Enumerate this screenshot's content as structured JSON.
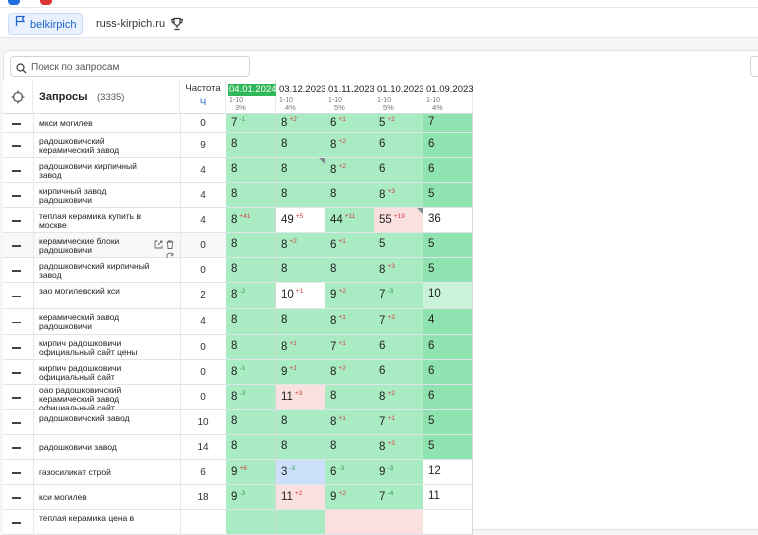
{
  "tabs": [
    {
      "label": "belkirpich",
      "active": true
    },
    {
      "label": "russ-kirpich.ru",
      "active": false
    }
  ],
  "search": {
    "placeholder": "Поиск по запросам"
  },
  "header": {
    "query_title": "Запросы",
    "query_count": "(3335)",
    "freq_title": "Частота",
    "freq_unit": "Ч"
  },
  "dates": [
    {
      "date": "04.01.2024",
      "range": "1-10",
      "pct": "3%",
      "current": true
    },
    {
      "date": "03.12.2023",
      "range": "1-10",
      "pct": "4%",
      "current": false
    },
    {
      "date": "01.11.2023",
      "range": "1-10",
      "pct": "5%",
      "current": false
    },
    {
      "date": "01.10.2023",
      "range": "1-10",
      "pct": "5%",
      "current": false
    },
    {
      "date": "01.09.2023",
      "range": "1-10",
      "pct": "4%",
      "current": false
    }
  ],
  "colors": {
    "green_light": "#c9f3d8",
    "green": "#a9ecc4",
    "green_strong": "#8fe3b0",
    "pink": "#fbe0e0",
    "blue": "#cde0fb",
    "white": "#ffffff",
    "accent": "#1f64c8",
    "current_date": "#2fb85a"
  },
  "rows": [
    {
      "query": "мкси могилев",
      "freq": "0",
      "cells": [
        [
          "7",
          "-1",
          "dn",
          "g",
          0
        ],
        [
          "8",
          "+2",
          "up",
          "g",
          0
        ],
        [
          "6",
          "+1",
          "up",
          "g",
          0
        ],
        [
          "5",
          "+2",
          "up",
          "g",
          0
        ],
        [
          "7",
          "",
          "",
          "gs",
          0
        ]
      ]
    },
    {
      "query": "радошковичский керамический завод",
      "freq": "9",
      "cells": [
        [
          "8",
          "",
          "",
          "g",
          0
        ],
        [
          "8",
          "",
          "",
          "g",
          0
        ],
        [
          "8",
          "+2",
          "up",
          "g",
          0
        ],
        [
          "6",
          "",
          "",
          "g",
          0
        ],
        [
          "6",
          "",
          "",
          "gs",
          0
        ]
      ]
    },
    {
      "query": "радошковичи кирпичный завод",
      "freq": "4",
      "cells": [
        [
          "8",
          "",
          "",
          "g",
          0
        ],
        [
          "8",
          "",
          "",
          "g",
          1
        ],
        [
          "8",
          "+2",
          "up",
          "g",
          0
        ],
        [
          "6",
          "",
          "",
          "g",
          0
        ],
        [
          "6",
          "",
          "",
          "gs",
          0
        ]
      ]
    },
    {
      "query": "кирпичный завод радошковичи",
      "freq": "4",
      "cells": [
        [
          "8",
          "",
          "",
          "g",
          0
        ],
        [
          "8",
          "",
          "",
          "g",
          0
        ],
        [
          "8",
          "",
          "",
          "g",
          0
        ],
        [
          "8",
          "+3",
          "up",
          "g",
          0
        ],
        [
          "5",
          "",
          "",
          "gs",
          0
        ]
      ]
    },
    {
      "query": "теплая керамика купить в москве",
      "freq": "4",
      "cells": [
        [
          "8",
          "+41",
          "up",
          "g",
          0
        ],
        [
          "49",
          "+5",
          "up",
          "w",
          0
        ],
        [
          "44",
          "+11",
          "up",
          "g",
          0
        ],
        [
          "55",
          "+19",
          "up",
          "p",
          1
        ],
        [
          "36",
          "",
          "",
          "w",
          0
        ]
      ]
    },
    {
      "query": "керамические блоки радошковичи",
      "freq": "0",
      "hl": true,
      "cells": [
        [
          "8",
          "",
          "",
          "g",
          0
        ],
        [
          "8",
          "+2",
          "up",
          "g",
          0
        ],
        [
          "6",
          "+1",
          "up",
          "g",
          0
        ],
        [
          "5",
          "",
          "",
          "g",
          0
        ],
        [
          "5",
          "",
          "",
          "gs",
          0
        ]
      ]
    },
    {
      "query": "радошковичский кирпичный завод",
      "freq": "0",
      "cells": [
        [
          "8",
          "",
          "",
          "g",
          0
        ],
        [
          "8",
          "",
          "",
          "g",
          0
        ],
        [
          "8",
          "",
          "",
          "g",
          0
        ],
        [
          "8",
          "+3",
          "up",
          "g",
          0
        ],
        [
          "5",
          "",
          "",
          "gs",
          0
        ]
      ]
    },
    {
      "query": "зао могилевский кси",
      "freq": "2",
      "cells": [
        [
          "8",
          "-2",
          "dn",
          "g",
          0
        ],
        [
          "10",
          "+1",
          "up",
          "w",
          0
        ],
        [
          "9",
          "+2",
          "up",
          "g",
          0
        ],
        [
          "7",
          "-3",
          "dn",
          "g",
          0
        ],
        [
          "10",
          "",
          "",
          "gl",
          0
        ]
      ]
    },
    {
      "query": "керамический завод радошковичи",
      "freq": "4",
      "cells": [
        [
          "8",
          "",
          "",
          "g",
          0
        ],
        [
          "8",
          "",
          "",
          "g",
          0
        ],
        [
          "8",
          "+1",
          "up",
          "g",
          0
        ],
        [
          "7",
          "+3",
          "up",
          "g",
          0
        ],
        [
          "4",
          "",
          "",
          "gs",
          0
        ]
      ]
    },
    {
      "query": "кирпич радошковичи официальный сайт цены",
      "freq": "0",
      "cells": [
        [
          "8",
          "",
          "",
          "g",
          0
        ],
        [
          "8",
          "+1",
          "up",
          "g",
          0
        ],
        [
          "7",
          "+1",
          "up",
          "g",
          0
        ],
        [
          "6",
          "",
          "",
          "g",
          0
        ],
        [
          "6",
          "",
          "",
          "gs",
          0
        ]
      ]
    },
    {
      "query": "кирпич радошковичи официальный сайт",
      "freq": "0",
      "cells": [
        [
          "8",
          "-1",
          "dn",
          "g",
          0
        ],
        [
          "9",
          "+1",
          "up",
          "g",
          0
        ],
        [
          "8",
          "+2",
          "up",
          "g",
          0
        ],
        [
          "6",
          "",
          "",
          "g",
          0
        ],
        [
          "6",
          "",
          "",
          "gs",
          0
        ]
      ]
    },
    {
      "query": "оао радошковичский керамический завод официальный сайт",
      "freq": "0",
      "cells": [
        [
          "8",
          "-3",
          "dn",
          "g",
          0
        ],
        [
          "11",
          "+3",
          "up",
          "p",
          0
        ],
        [
          "8",
          "",
          "",
          "g",
          0
        ],
        [
          "8",
          "+2",
          "up",
          "g",
          0
        ],
        [
          "6",
          "",
          "",
          "gs",
          0
        ]
      ]
    },
    {
      "query": "радошковичский завод",
      "freq": "10",
      "cells": [
        [
          "8",
          "",
          "",
          "g",
          0
        ],
        [
          "8",
          "",
          "",
          "g",
          0
        ],
        [
          "8",
          "+1",
          "up",
          "g",
          0
        ],
        [
          "7",
          "+1",
          "up",
          "g",
          0
        ],
        [
          "5",
          "",
          "",
          "gs",
          0
        ]
      ]
    },
    {
      "query": "радошковичи завод",
      "freq": "14",
      "cells": [
        [
          "8",
          "",
          "",
          "g",
          0
        ],
        [
          "8",
          "",
          "",
          "g",
          0
        ],
        [
          "8",
          "",
          "",
          "g",
          0
        ],
        [
          "8",
          "+3",
          "up",
          "g",
          0
        ],
        [
          "5",
          "",
          "",
          "gs",
          0
        ]
      ]
    },
    {
      "query": "газосиликат строй",
      "freq": "6",
      "cells": [
        [
          "9",
          "+6",
          "up",
          "g",
          0
        ],
        [
          "3",
          "-3",
          "dn",
          "b",
          0
        ],
        [
          "6",
          "-3",
          "dn",
          "g",
          0
        ],
        [
          "9",
          "-3",
          "dn",
          "g",
          0
        ],
        [
          "12",
          "",
          "",
          "w",
          0
        ]
      ]
    },
    {
      "query": "кси могилев",
      "freq": "18",
      "cells": [
        [
          "9",
          "-3",
          "dn",
          "g",
          0
        ],
        [
          "11",
          "+2",
          "up",
          "p",
          0
        ],
        [
          "9",
          "+2",
          "up",
          "g",
          0
        ],
        [
          "7",
          "-4",
          "dn",
          "g",
          0
        ],
        [
          "11",
          "",
          "",
          "w",
          0
        ]
      ]
    },
    {
      "query": "теплая керамика цена в",
      "freq": "",
      "cells": [
        [
          "",
          "",
          "",
          "g",
          0
        ],
        [
          "",
          "",
          "",
          "g",
          0
        ],
        [
          "",
          "",
          "",
          "p",
          0
        ],
        [
          "",
          "",
          "",
          "p",
          0
        ],
        [
          "",
          "",
          "",
          "w",
          0
        ]
      ]
    }
  ]
}
